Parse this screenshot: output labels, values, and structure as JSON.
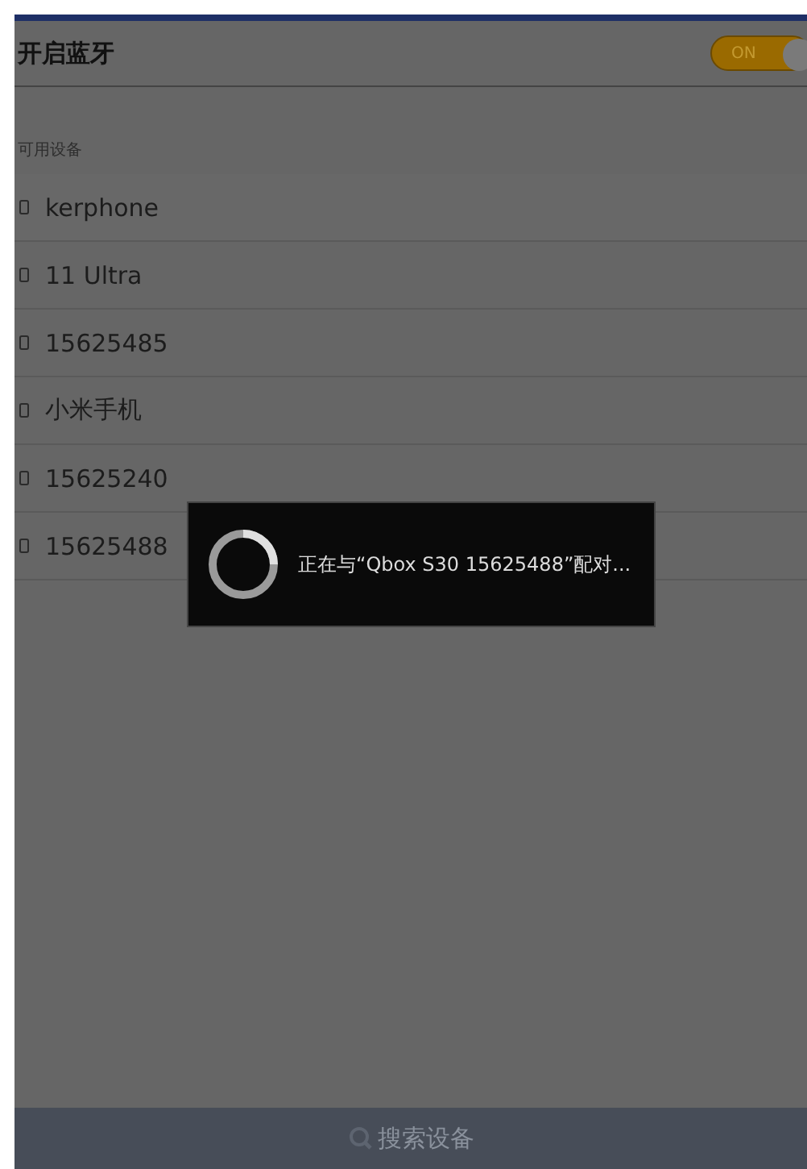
{
  "header": {
    "title": "开启蓝牙",
    "toggle": {
      "label": "ON",
      "on": true
    }
  },
  "section_label": "可用设备",
  "devices": [
    {
      "name": "kerphone"
    },
    {
      "name": "11 Ultra"
    },
    {
      "name": "15625485"
    },
    {
      "name": "小米手机"
    },
    {
      "name": "15625240"
    },
    {
      "name": "15625488"
    }
  ],
  "dialog": {
    "message": "正在与“Qbox S30 15625488”配对..."
  },
  "search_button": {
    "label": "搜索设备"
  }
}
